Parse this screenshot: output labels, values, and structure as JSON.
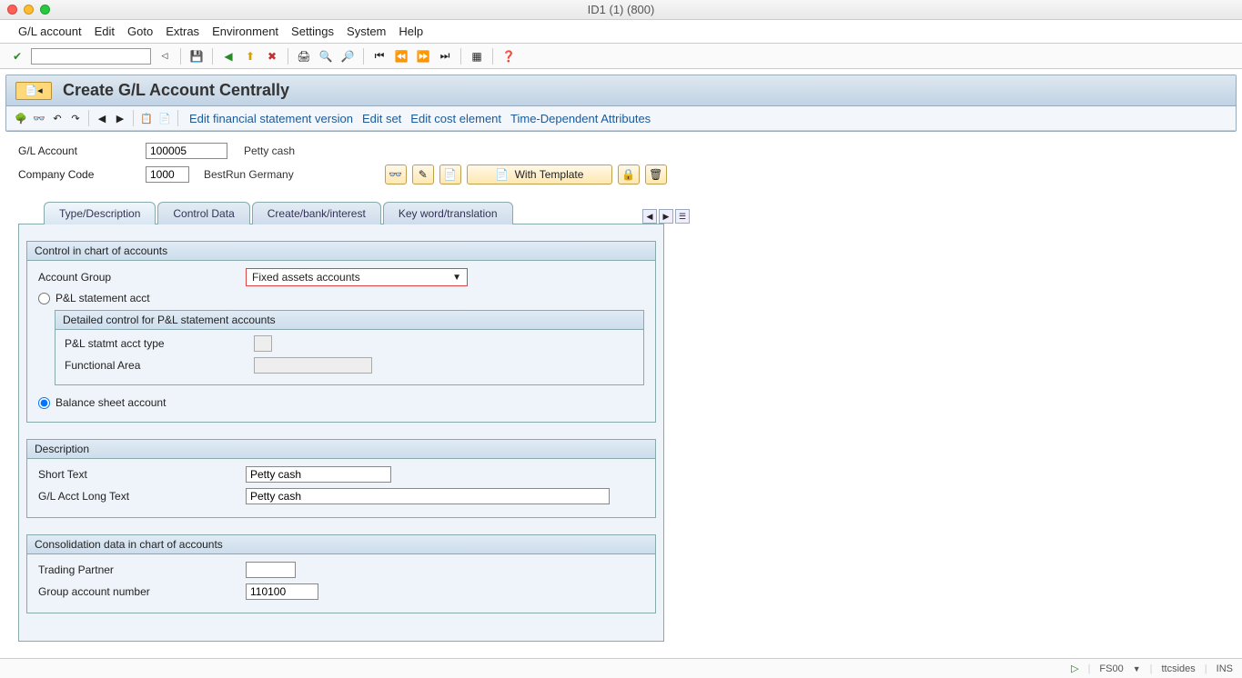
{
  "window": {
    "title": "ID1 (1) (800)"
  },
  "menu": [
    "G/L account",
    "Edit",
    "Goto",
    "Extras",
    "Environment",
    "Settings",
    "System",
    "Help"
  ],
  "page": {
    "title": "Create G/L Account Centrally",
    "toolbar_links": [
      "Edit financial statement version",
      "Edit set",
      "Edit cost element",
      "Time-Dependent Attributes"
    ]
  },
  "header": {
    "gl_account_label": "G/L Account",
    "gl_account_value": "100005",
    "gl_account_desc": "Petty cash",
    "company_code_label": "Company Code",
    "company_code_value": "1000",
    "company_code_desc": "BestRun Germany",
    "with_template_label": "With Template"
  },
  "tabs": [
    "Type/Description",
    "Control Data",
    "Create/bank/interest",
    "Key word/translation"
  ],
  "group_control": {
    "title": "Control in chart of accounts",
    "account_group_label": "Account Group",
    "account_group_value": "Fixed assets accounts",
    "radio_pl": "P&L statement acct",
    "inner_title": "Detailed control for P&L statement accounts",
    "pl_type_label": "P&L statmt acct type",
    "func_area_label": "Functional Area",
    "radio_bs": "Balance sheet account"
  },
  "group_desc": {
    "title": "Description",
    "short_label": "Short Text",
    "short_value": "Petty cash",
    "long_label": "G/L Acct Long Text",
    "long_value": "Petty cash"
  },
  "group_cons": {
    "title": "Consolidation data in chart of accounts",
    "trading_label": "Trading Partner",
    "group_acc_label": "Group account number",
    "group_acc_value": "110100"
  },
  "status": {
    "tcode": "FS00",
    "user": "ttcsides",
    "mode": "INS"
  }
}
